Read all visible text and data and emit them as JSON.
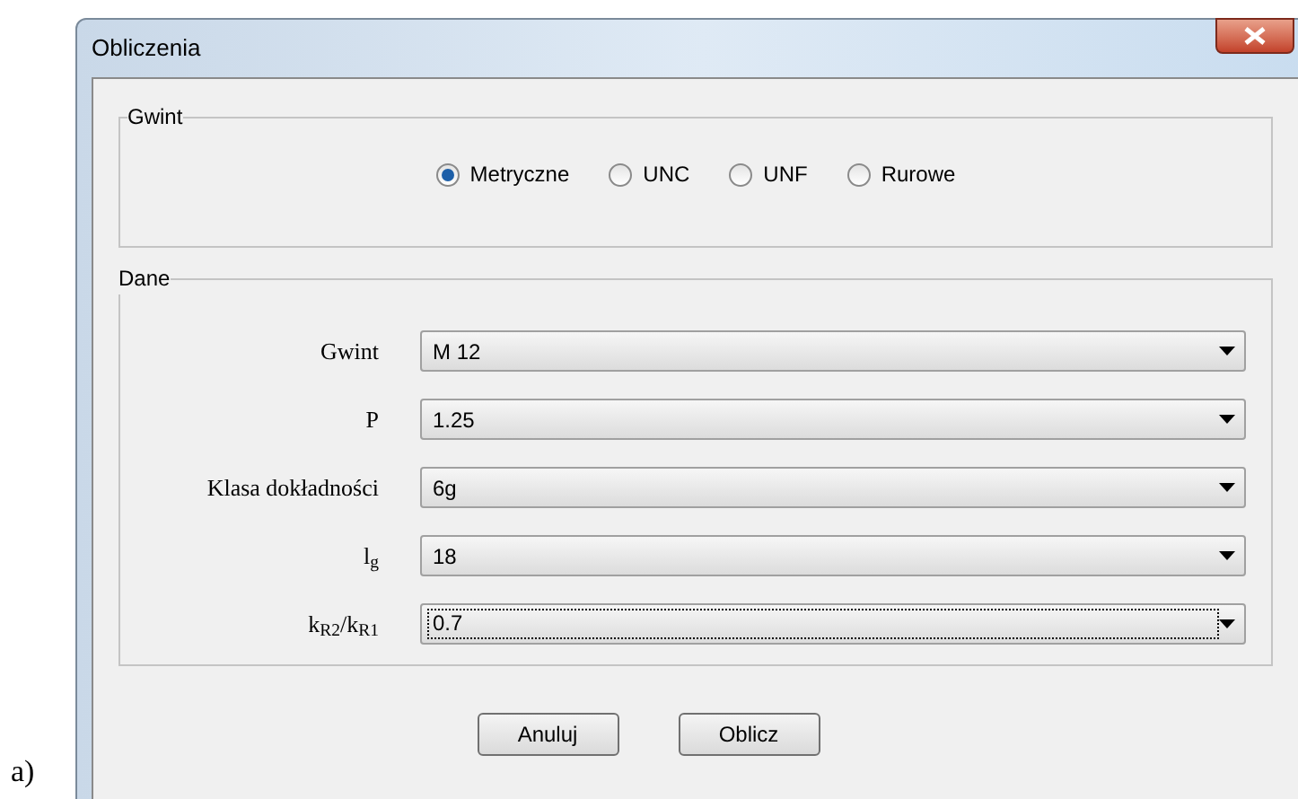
{
  "caption": "a)",
  "window": {
    "title": "Obliczenia"
  },
  "thread_group": {
    "title": "Gwint",
    "options": [
      {
        "label": "Metryczne",
        "selected": true
      },
      {
        "label": "UNC",
        "selected": false
      },
      {
        "label": "UNF",
        "selected": false
      },
      {
        "label": "Rurowe",
        "selected": false
      }
    ]
  },
  "data_group": {
    "title": "Dane",
    "fields": [
      {
        "label": "Gwint",
        "value": "M 12",
        "focused": false
      },
      {
        "label": "P",
        "value": "1.25",
        "focused": false
      },
      {
        "label": "Klasa dokładności",
        "value": "6g",
        "focused": false
      },
      {
        "label": "l$_{g}$",
        "value": "18",
        "focused": false
      },
      {
        "label": "k$_{R2}$/k$_{R1}$",
        "value": "0.7",
        "focused": true
      }
    ]
  },
  "buttons": [
    "Anuluj",
    "Oblicz"
  ]
}
